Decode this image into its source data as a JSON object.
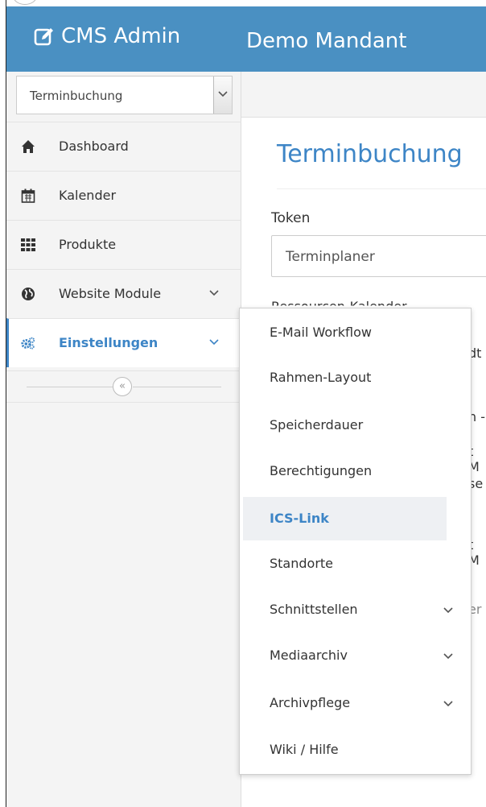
{
  "header": {
    "brand": "CMS Admin",
    "brand_icon": "edit-icon",
    "mandant": "Demo Mandant",
    "color": "#4a90c2"
  },
  "sidebar": {
    "selector_value": "Terminbuchung",
    "items": [
      {
        "label": "Dashboard",
        "icon": "home-icon"
      },
      {
        "label": "Kalender",
        "icon": "calendar-icon"
      },
      {
        "label": "Produkte",
        "icon": "grid-icon"
      },
      {
        "label": "Website Module",
        "icon": "globe-icon"
      },
      {
        "label": "Einstellungen",
        "icon": "cogs-icon",
        "active": true
      }
    ],
    "collapse_glyph": "«",
    "accent": "#3d85c6"
  },
  "main": {
    "title": "Terminbuchung",
    "token_label": "Token",
    "token_value": "Terminplaner",
    "behind_fragments": [
      "Ressourcen-Kalender",
      "dt",
      "n -",
      "t M",
      "se",
      "t M",
      "er"
    ]
  },
  "menu": {
    "items": [
      {
        "label": "E-Mail Workflow"
      },
      {
        "label": "Rahmen-Layout"
      },
      {
        "label": "Speicherdauer"
      },
      {
        "label": "Berechtigungen"
      },
      {
        "label": "ICS-Link",
        "highlight": true
      },
      {
        "label": "Standorte"
      },
      {
        "label": "Schnittstellen",
        "submenu": true
      },
      {
        "label": "Mediaarchiv",
        "submenu": true
      },
      {
        "label": "Archivpflege",
        "submenu": true
      },
      {
        "label": "Wiki / Hilfe"
      }
    ]
  }
}
